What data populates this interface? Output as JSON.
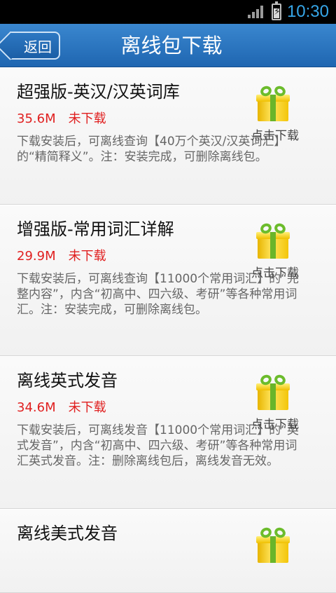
{
  "status_bar": {
    "time": "10:30"
  },
  "header": {
    "back_label": "返回",
    "title": "离线包下载"
  },
  "items": [
    {
      "name": "超强版-英汉/汉英词库",
      "size": "35.6M",
      "status": "未下载",
      "action": "点击下载",
      "desc": "下载安装后，可离线查询【40万个英汉/汉英词汇】的“精简释义”。注：安装完成，可删除离线包。"
    },
    {
      "name": "增强版-常用词汇详解",
      "size": "29.9M",
      "status": "未下载",
      "action": "点击下载",
      "desc": "下载安装后，可离线查询【11000个常用词汇】的“完整内容”，内含“初高中、四六级、考研”等各种常用词汇。注：安装完成，可删除离线包。"
    },
    {
      "name": "离线英式发音",
      "size": "34.6M",
      "status": "未下载",
      "action": "点击下载",
      "desc": "下载安装后，可离线发音【11000个常用词汇】的“英式发音”，内含“初高中、四六级、考研”等各种常用词汇英式发音。注：删除离线包后，离线发音无效。"
    },
    {
      "name": "离线美式发音",
      "size": "",
      "status": "",
      "action": "",
      "desc": ""
    }
  ],
  "icons": {
    "download": "gift-icon"
  }
}
